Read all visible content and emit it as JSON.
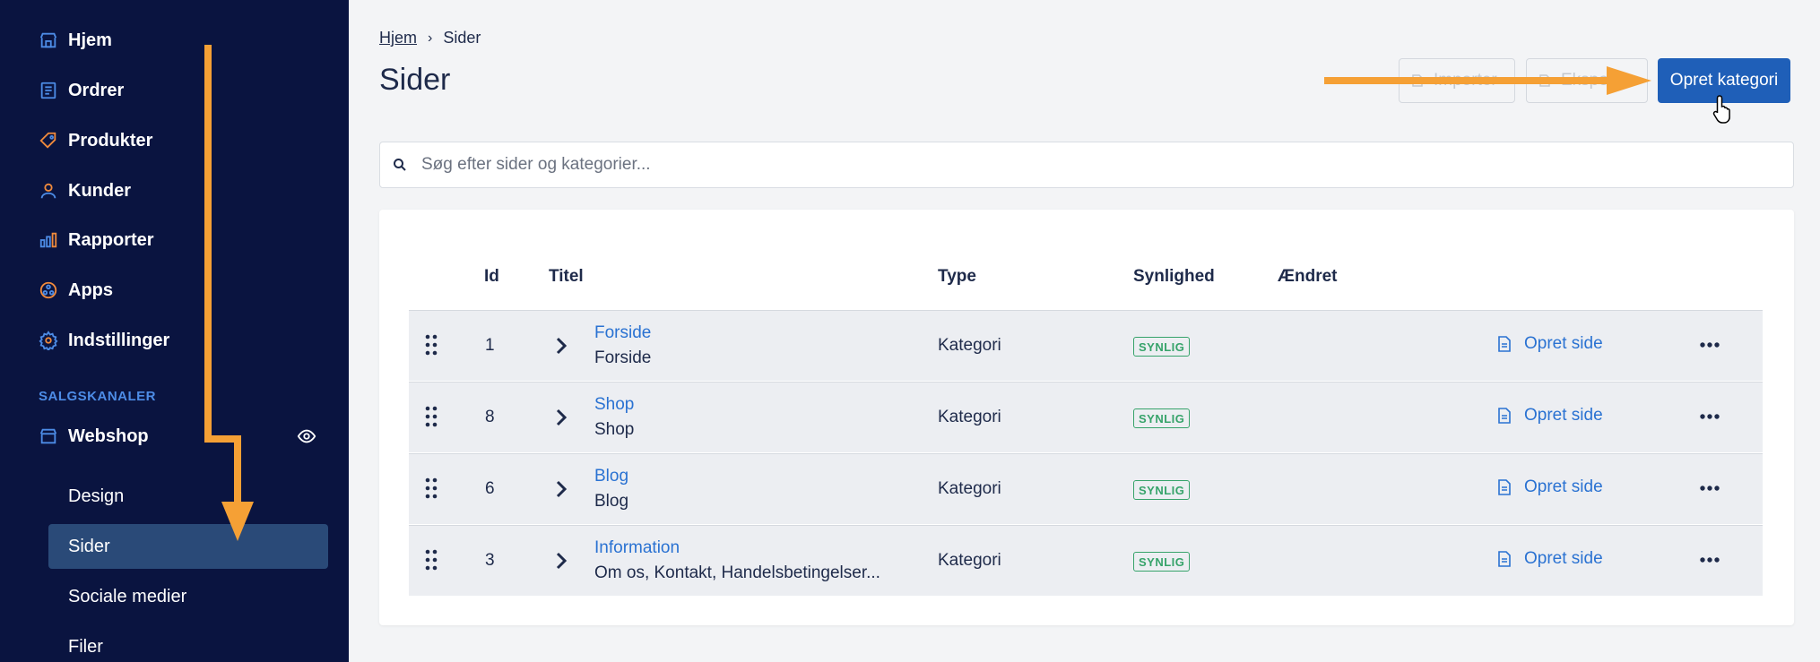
{
  "sidebar": {
    "nav": [
      {
        "label": "Hjem",
        "icon": "store-icon"
      },
      {
        "label": "Ordrer",
        "icon": "orders-icon"
      },
      {
        "label": "Produkter",
        "icon": "tag-icon"
      },
      {
        "label": "Kunder",
        "icon": "person-icon"
      },
      {
        "label": "Rapporter",
        "icon": "bar-chart-icon"
      },
      {
        "label": "Apps",
        "icon": "apps-icon"
      },
      {
        "label": "Indstillinger",
        "icon": "gear-icon"
      }
    ],
    "section_label": "SALGSKANALER",
    "channel": {
      "label": "Webshop",
      "icon": "webshop-icon"
    },
    "sub_items": [
      {
        "label": "Design"
      },
      {
        "label": "Sider",
        "active": true
      },
      {
        "label": "Sociale medier"
      },
      {
        "label": "Filer"
      }
    ]
  },
  "breadcrumb": {
    "home": "Hjem",
    "current": "Sider"
  },
  "page_title": "Sider",
  "actions": {
    "import_label": "Importer",
    "export_label": "Eksporter",
    "create_label": "Opret kategori"
  },
  "search": {
    "placeholder": "Søg efter sider og kategorier..."
  },
  "table": {
    "headers": {
      "id": "Id",
      "title": "Titel",
      "type": "Type",
      "visibility": "Synlighed",
      "changed": "Ændret"
    },
    "rows": [
      {
        "id": "1",
        "title": "Forside",
        "subtitle": "Forside",
        "type": "Kategori",
        "visibility": "SYNLIG",
        "action": "Opret side"
      },
      {
        "id": "8",
        "title": "Shop",
        "subtitle": "Shop",
        "type": "Kategori",
        "visibility": "SYNLIG",
        "action": "Opret side"
      },
      {
        "id": "6",
        "title": "Blog",
        "subtitle": "Blog",
        "type": "Kategori",
        "visibility": "SYNLIG",
        "action": "Opret side"
      },
      {
        "id": "3",
        "title": "Information",
        "subtitle": "Om os, Kontakt, Handelsbetingelser...",
        "type": "Kategori",
        "visibility": "SYNLIG",
        "action": "Opret side"
      }
    ]
  },
  "colors": {
    "sidebar_bg": "#0a1440",
    "active_item": "#2a4a78",
    "primary": "#1f5fb8",
    "link": "#2a72d2",
    "badge": "#36a36a",
    "annotation_arrow": "#f5a035"
  }
}
